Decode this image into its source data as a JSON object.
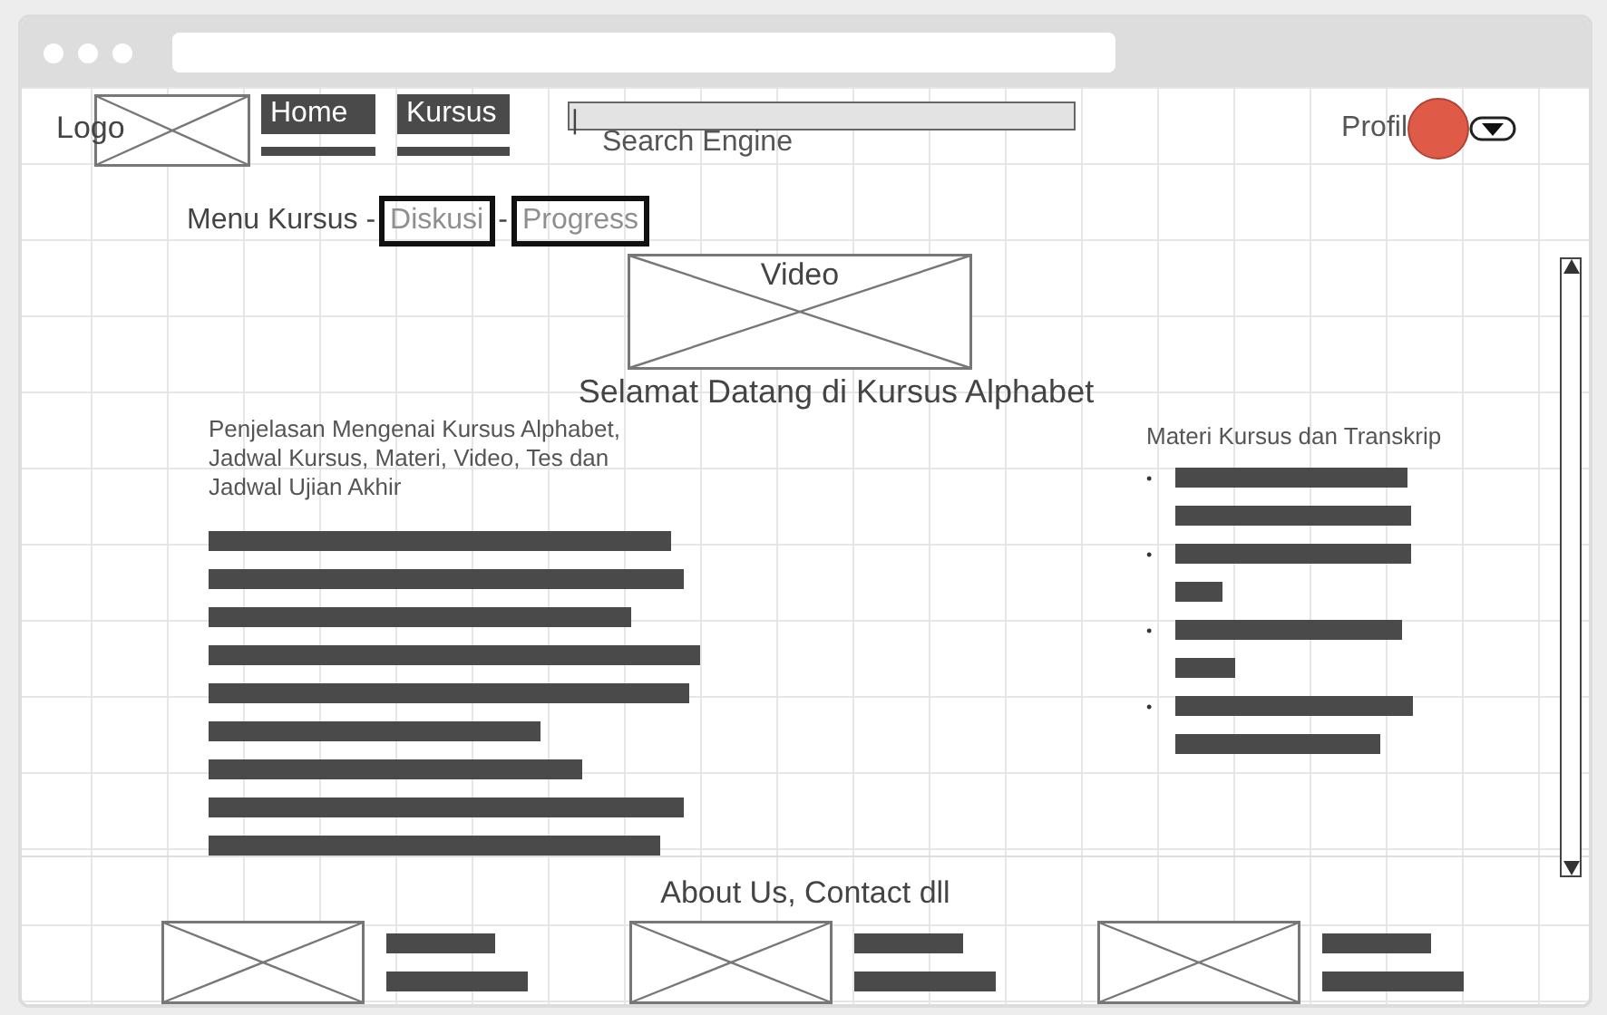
{
  "header": {
    "logo": "Logo",
    "nav": [
      {
        "label": "Home"
      },
      {
        "label": "Kursus"
      }
    ],
    "search": {
      "caret": "|",
      "label": "Search Engine"
    },
    "profile": {
      "label": "Profil"
    }
  },
  "submenu": {
    "label": "Menu Kursus -",
    "separator": "-",
    "items": [
      {
        "label": "Diskusi",
        "disabled": true
      },
      {
        "label": "Progress",
        "disabled": true
      }
    ]
  },
  "video": {
    "label": "Video"
  },
  "title": "Selamat Datang di Kursus Alphabet",
  "description": "Penjelasan Mengenai Kursus Alphabet, Jadwal Kursus, Materi, Video, Tes dan Jadwal Ujian Akhir",
  "materials": {
    "title": "Materi Kursus dan Transkrip",
    "bullet": "•"
  },
  "footer": {
    "title": "About Us, Contact dll"
  }
}
